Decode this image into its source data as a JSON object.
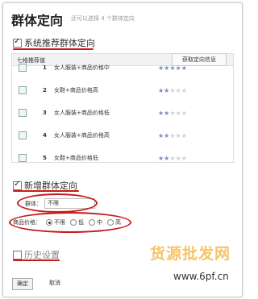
{
  "dialog": {
    "title": "群体定向",
    "subtitle": "还可以选择 4 个群体定向"
  },
  "system_section": {
    "label": "系统推荐群体定向",
    "checked": true
  },
  "table": {
    "header_label": "七格推荐值",
    "header_button": "获取定向信息",
    "rows": [
      {
        "num": "1",
        "text": "女人服装+商品价格中",
        "rating": 5
      },
      {
        "num": "2",
        "text": "女鞋+商品价格高",
        "rating": 2
      },
      {
        "num": "3",
        "text": "女人服装+商品价格低",
        "rating": 2
      },
      {
        "num": "4",
        "text": "女人服装+商品价格高",
        "rating": 2
      },
      {
        "num": "5",
        "text": "女鞋+商品价格低",
        "rating": 2
      }
    ]
  },
  "new_section": {
    "label": "新增群体定向",
    "checked": true,
    "group_label": "群体：",
    "group_value": "不限",
    "price_label": "商品价格：",
    "price_options": [
      "不限",
      "低",
      "中",
      "高"
    ],
    "price_selected": "不限"
  },
  "history_section": {
    "label": "历史设置",
    "checked": false
  },
  "footer": {
    "ok_label": "确定",
    "cancel_label": "取消"
  },
  "watermark": {
    "main": "货源批发网",
    "url": "www.6pf.cn"
  },
  "colors": {
    "annotation_red": "#c81a1a",
    "star_on": "#7a8fb5",
    "star_off": "#d0d0d0",
    "watermark": "#f5c46a"
  }
}
